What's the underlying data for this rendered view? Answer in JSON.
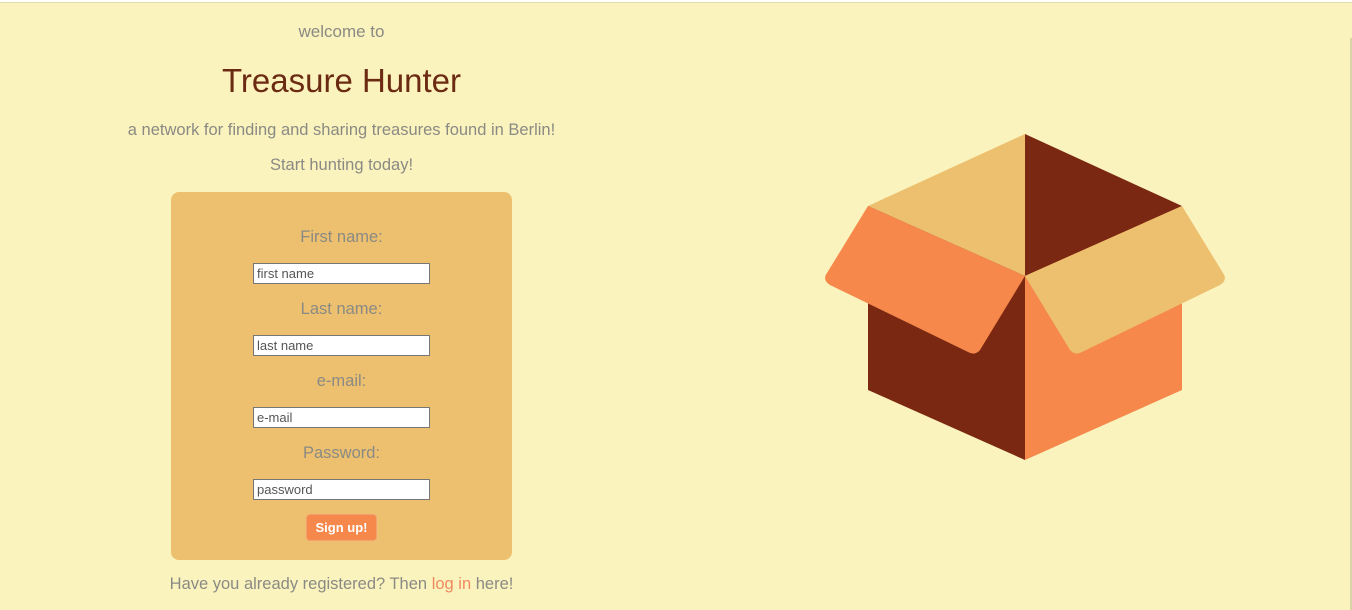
{
  "header": {
    "welcome": "welcome to",
    "title": "Treasure Hunter",
    "tagline": "a network for finding and sharing treasures found in Berlin!",
    "cta": "Start hunting today!"
  },
  "form": {
    "fields": [
      {
        "label": "First name:",
        "placeholder": "first name"
      },
      {
        "label": "Last name:",
        "placeholder": "last name"
      },
      {
        "label": "e-mail:",
        "placeholder": "e-mail"
      },
      {
        "label": "Password:",
        "placeholder": "password"
      }
    ],
    "submit_label": "Sign up!"
  },
  "footer": {
    "prefix": "Have you already registered? Then ",
    "link": "log in",
    "suffix": " here!"
  },
  "colors": {
    "background": "#fbf3bd",
    "card": "#edc06f",
    "title": "#6b2a12",
    "accent": "#f5884a",
    "box_dark": "#7a2812",
    "box_orange": "#f5884a",
    "box_tan": "#edc06f"
  },
  "illustration": {
    "icon": "open-box-icon"
  }
}
